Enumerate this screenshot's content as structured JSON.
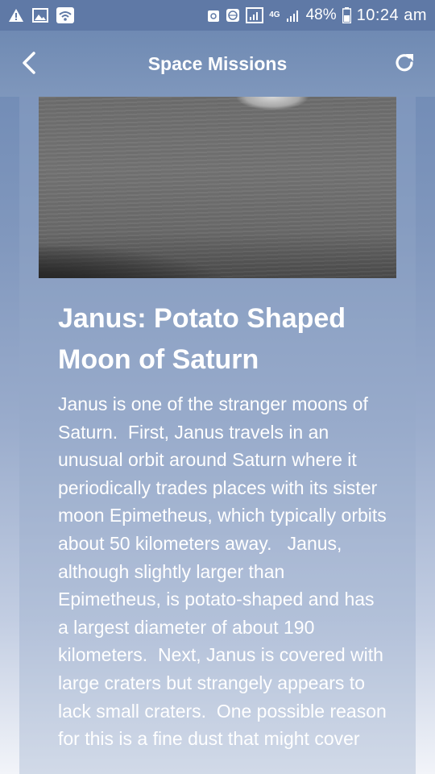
{
  "status_bar": {
    "notification_icons": [
      "warning-icon",
      "image-icon",
      "wifi-icon"
    ],
    "system_icons": [
      "recycle-icon",
      "globe-icon",
      "signal-icon",
      "4g-icon",
      "cell-signal-icon",
      "battery-icon"
    ],
    "network_label": "4G",
    "battery": "48%",
    "time": "10:24 am"
  },
  "app_bar": {
    "title": "Space Missions",
    "back_icon": "chevron-left-icon",
    "refresh_icon": "refresh-icon"
  },
  "article": {
    "title": "Janus: Potato Shaped Moon of Saturn",
    "body": "Janus is one of the stranger moons of Saturn.  First, Janus travels in an unusual orbit around Saturn where it periodically trades places with its sister moon Epimetheus, which typically orbits about 50 kilometers away.   Janus, although slightly larger than Epimetheus, is potato-shaped and has a largest diameter of about 190 kilometers.  Next, Janus is covered with large craters but strangely appears to lack small craters.  One possible reason for this is a fine dust that might cover"
  },
  "colors": {
    "status_bar": "#5f79a6",
    "app_bar": "#7890b8",
    "text": "#ffffff"
  }
}
